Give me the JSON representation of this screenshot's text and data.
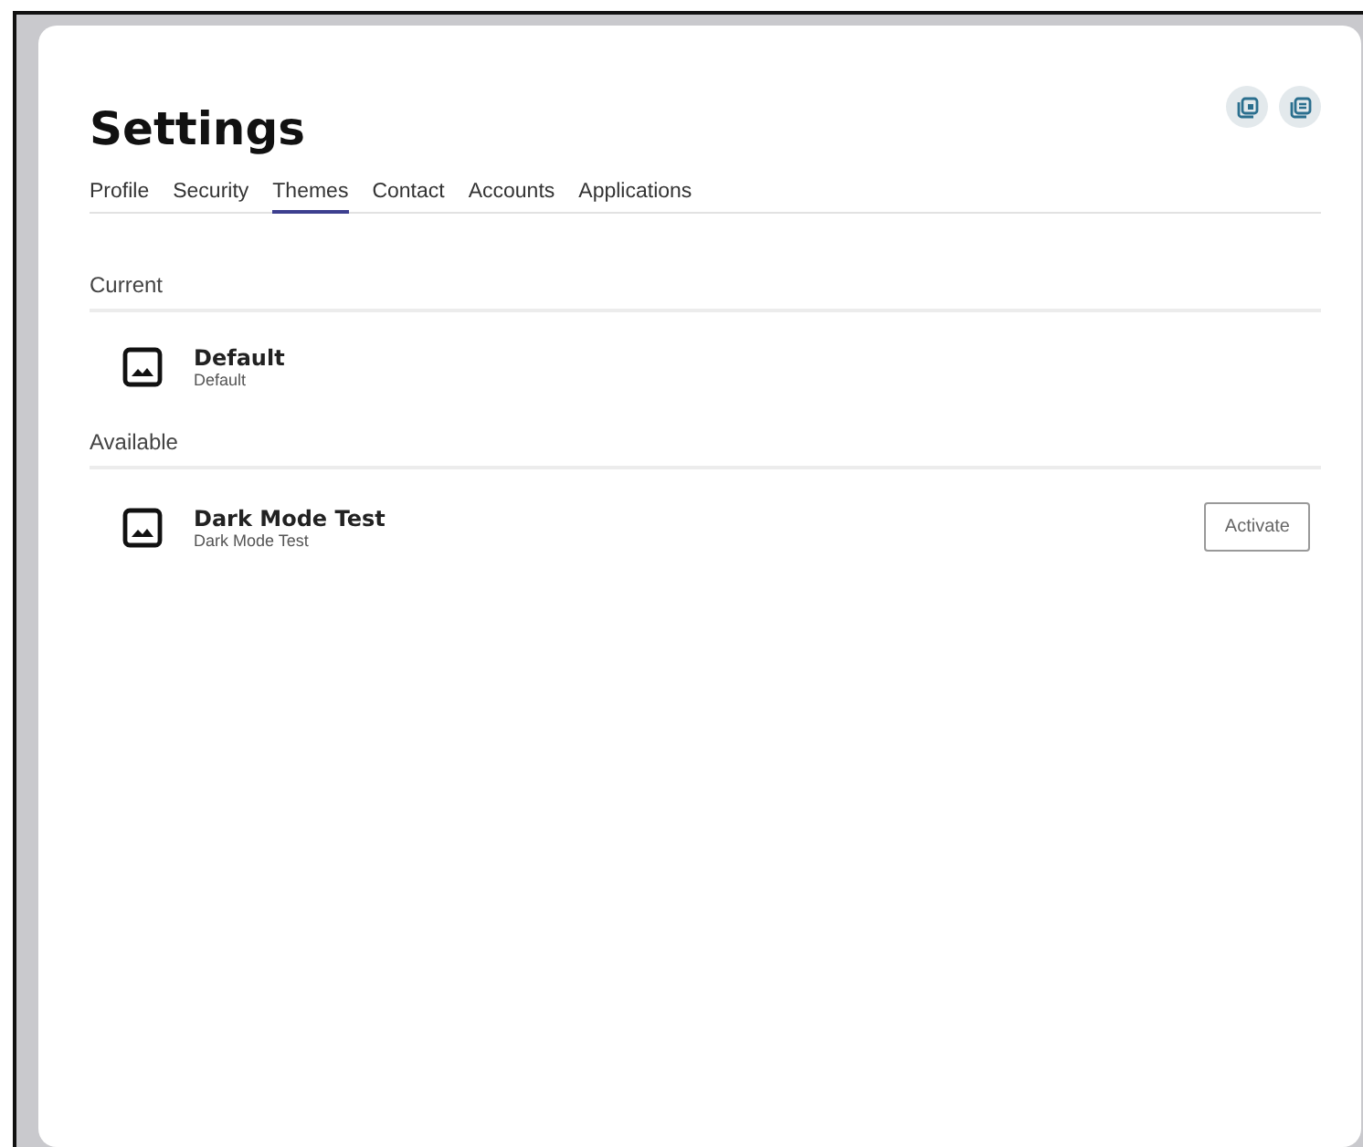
{
  "title": "Settings",
  "tabs": [
    {
      "label": "Profile",
      "selected": false
    },
    {
      "label": "Security",
      "selected": false
    },
    {
      "label": "Themes",
      "selected": true
    },
    {
      "label": "Contact",
      "selected": false
    },
    {
      "label": "Accounts",
      "selected": false
    },
    {
      "label": "Applications",
      "selected": false
    }
  ],
  "sections": [
    {
      "heading": "Current",
      "items": [
        {
          "name": "Default",
          "description": "Default"
        }
      ]
    },
    {
      "heading": "Available",
      "items": [
        {
          "name": "Dark Mode Test",
          "description": "Dark Mode Test",
          "action": "Activate"
        }
      ]
    }
  ]
}
